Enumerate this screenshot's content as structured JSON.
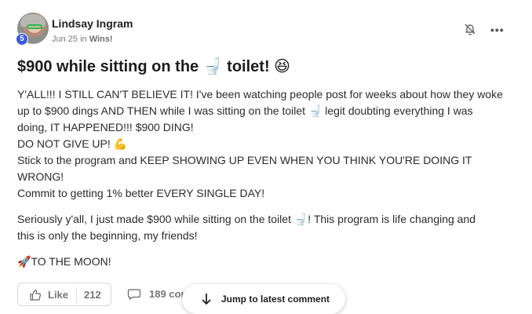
{
  "author": {
    "name": "Lindsay Ingram",
    "level": "5",
    "date": "Jun 25",
    "in_word": "in",
    "category": "Wins!"
  },
  "post": {
    "title": "$900 while sitting on the 🚽 toilet! 😆",
    "body_lines": [
      "Y'ALL!!! I STILL CAN'T BELIEVE IT! I've been watching people post for weeks about how they woke",
      "up to $900 dings AND THEN while I was sitting on the toilet 🚽 legit doubting everything I was",
      "doing, IT HAPPENED!!! $900 DING!",
      "DO NOT GIVE UP! 💪",
      "Stick to the program and KEEP SHOWING UP EVEN WHEN YOU THINK YOU'RE DOING IT WRONG!",
      "Commit to getting 1% better EVERY SINGLE DAY!"
    ],
    "paragraph2_lines": [
      "Seriously y'all, I just made $900 while sitting on the toilet 🚽! This program is life changing and",
      "this is only the beginning, my friends!"
    ],
    "paragraph3": "🚀TO THE MOON!"
  },
  "actions": {
    "like_label": "Like",
    "like_count": "212",
    "comment_count_text": "189 cor"
  },
  "jump": {
    "label": "Jump to latest comment"
  },
  "icons": {
    "bell": "bell-off-icon",
    "more": "more-horizontal-icon",
    "like": "thumbs-up-icon",
    "comment": "comment-icon",
    "arrow": "arrow-down-icon"
  }
}
